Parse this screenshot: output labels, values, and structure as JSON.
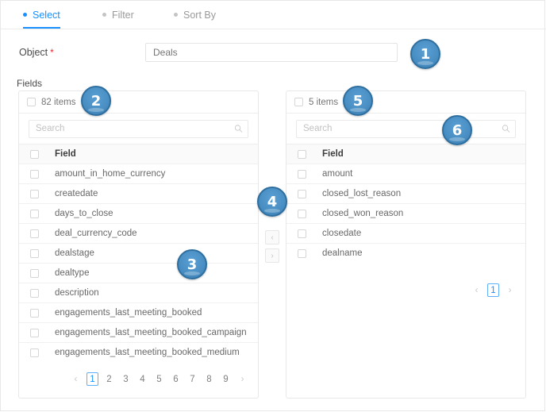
{
  "tabs": [
    {
      "label": "Select",
      "active": true
    },
    {
      "label": "Filter",
      "active": false
    },
    {
      "label": "Sort By",
      "active": false
    }
  ],
  "object_row": {
    "label": "Object",
    "required_mark": "*",
    "value": "Deals",
    "placeholder": "Deals"
  },
  "fields_section": {
    "label": "Fields"
  },
  "left_panel": {
    "count_label": "82 items",
    "search_placeholder": "Search",
    "column_header": "Field",
    "items": [
      "amount_in_home_currency",
      "createdate",
      "days_to_close",
      "deal_currency_code",
      "dealstage",
      "dealtype",
      "description",
      "engagements_last_meeting_booked",
      "engagements_last_meeting_booked_campaign",
      "engagements_last_meeting_booked_medium"
    ],
    "pagination": {
      "prev": "‹",
      "next": "›",
      "pages": [
        "1",
        "2",
        "3",
        "4",
        "5",
        "6",
        "7",
        "8",
        "9"
      ],
      "active_page": "1"
    }
  },
  "right_panel": {
    "count_label": "5 items",
    "search_placeholder": "Search",
    "column_header": "Field",
    "items": [
      "amount",
      "closed_lost_reason",
      "closed_won_reason",
      "closedate",
      "dealname"
    ],
    "pagination": {
      "prev": "‹",
      "next": "›",
      "pages": [
        "1"
      ],
      "active_page": "1"
    }
  },
  "transfer_buttons": {
    "move_left": "‹",
    "move_right": "›"
  },
  "callouts": [
    {
      "number": "1"
    },
    {
      "number": "2"
    },
    {
      "number": "3"
    },
    {
      "number": "4"
    },
    {
      "number": "5"
    },
    {
      "number": "6"
    }
  ],
  "colors": {
    "accent_blue": "#1890ff",
    "required_red": "#f5222d",
    "badge_blue": "#4a90c4",
    "border_grey": "#e8e8e8",
    "header_row_grey": "#fafafa"
  }
}
